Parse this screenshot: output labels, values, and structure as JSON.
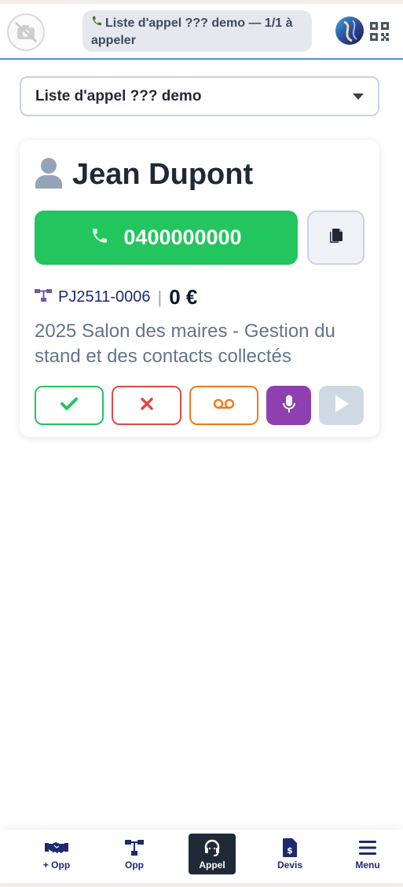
{
  "header": {
    "title": "Liste d'appel ??? demo — 1/1 à appeler",
    "icons": {
      "logo": "no-photo-icon",
      "brand": "brand-orb-icon",
      "qr": "qr-code-icon"
    }
  },
  "list_select": {
    "selected": "Liste d'appel ??? demo"
  },
  "contact": {
    "name": "Jean Dupont",
    "phone": "0400000000",
    "opportunity_ref": "PJ2511-0006",
    "amount": "0 €",
    "description": "2025 Salon des maires - Gestion du stand et des contacts collectés"
  },
  "actions": [
    "success-check",
    "fail-cross",
    "voicemail",
    "record-mic",
    "play"
  ],
  "bottom_nav": {
    "items": [
      {
        "label": "+ Opp",
        "icon": "handshake-icon"
      },
      {
        "label": "Opp",
        "icon": "sitemap-icon"
      },
      {
        "label": "Appel",
        "icon": "headset-icon",
        "active": true
      },
      {
        "label": "Devis",
        "icon": "invoice-dollar-icon"
      },
      {
        "label": "Menu",
        "icon": "menu-icon"
      }
    ]
  },
  "colors": {
    "call_green": "#22c55e",
    "fail_red": "#e04848",
    "voicemail_orange": "#f07a1a",
    "mic_purple": "#8e3fb0",
    "navy": "#1e2a6e",
    "header_border": "#4a90d9"
  }
}
